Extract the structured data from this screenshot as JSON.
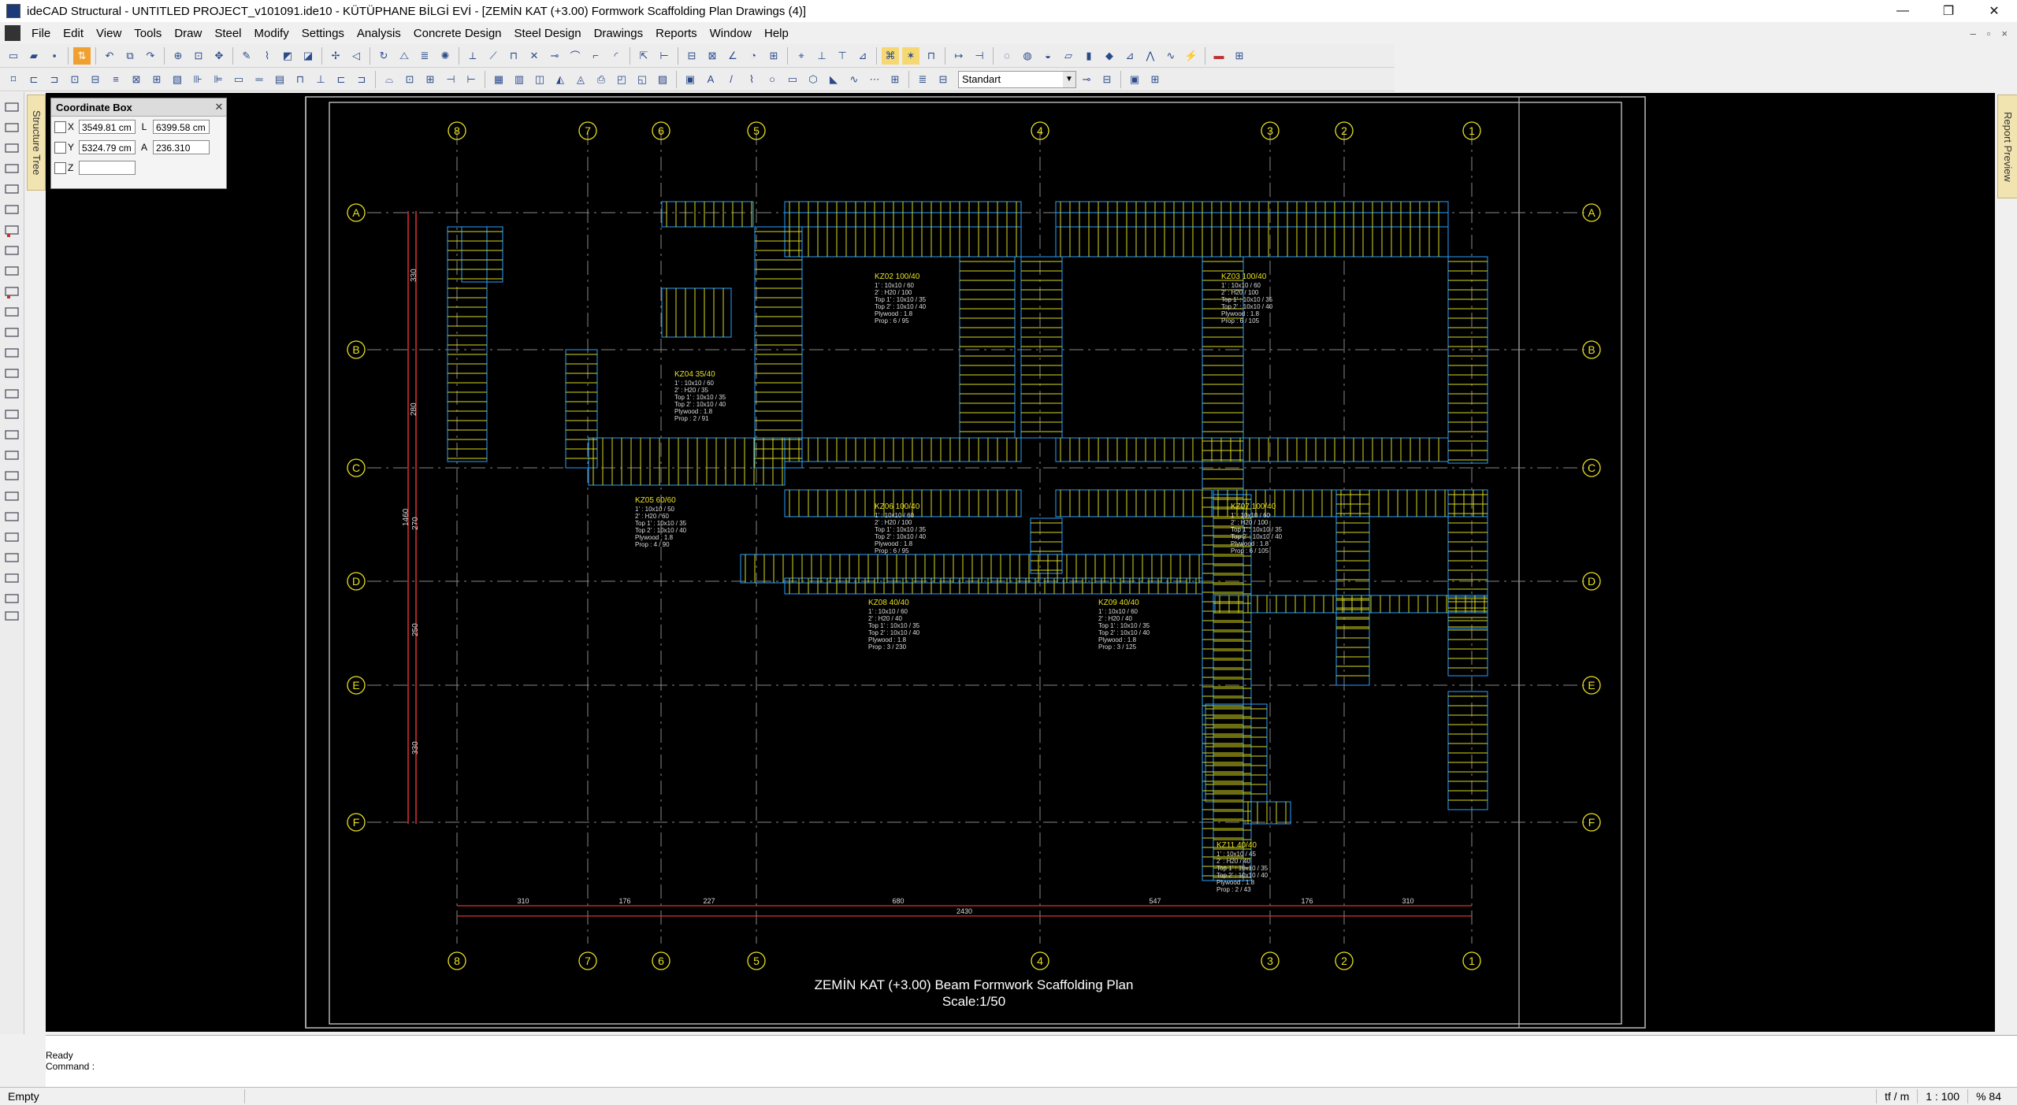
{
  "window": {
    "title": "ideCAD Structural - UNTITLED PROJECT_v101091.ide10 - KÜTÜPHANE BİLGİ EVİ - [ZEMİN KAT (+3.00) Formwork Scaffolding Plan Drawings (4)]",
    "minimize": "—",
    "maximize": "❐",
    "close": "✕"
  },
  "menu": {
    "items": [
      "File",
      "Edit",
      "View",
      "Tools",
      "Draw",
      "Steel",
      "Modify",
      "Settings",
      "Analysis",
      "Concrete Design",
      "Steel Design",
      "Drawings",
      "Reports",
      "Window",
      "Help"
    ],
    "mdi_controls": [
      "–",
      "▫",
      "×"
    ]
  },
  "toolbar": {
    "style_value": "Standart"
  },
  "side_tabs": {
    "left": "Structure Tree",
    "right": "Report Preview"
  },
  "coordinate_box": {
    "title": "Coordinate Box",
    "x_label": "X",
    "x_value": "3549.81 cm",
    "y_label": "Y",
    "y_value": "5324.79 cm",
    "z_label": "Z",
    "z_value": "",
    "l_label": "L",
    "l_value": "6399.58 cm",
    "a_label": "A",
    "a_value": "236.310"
  },
  "drawing": {
    "axes_x": [
      "8",
      "7",
      "6",
      "5",
      "4",
      "3",
      "2",
      "1"
    ],
    "axes_y": [
      "A",
      "B",
      "C",
      "D",
      "E",
      "F"
    ],
    "title": "ZEMİN KAT (+3.00) Beam Formwork Scaffolding Plan",
    "scale": "Scale:1/50",
    "bottom_dims": [
      "310",
      "176",
      "227",
      "680",
      "547",
      "176",
      "310"
    ],
    "total_dim": "2430",
    "left_dims": [
      "330",
      "280",
      "270",
      "250",
      "330"
    ],
    "left_total": "1460",
    "beams": [
      {
        "id": "KZ02 100/40",
        "lines": [
          "1' : 10x10 / 60",
          "2' : H20 / 100",
          "Top 1' : 10x10 / 35",
          "Top 2' : 10x10 / 40",
          "Plywood : 1.8",
          "Prop : 6 / 95"
        ]
      },
      {
        "id": "KZ03 100/40",
        "lines": [
          "1' : 10x10 / 60",
          "2' : H20 / 100",
          "Top 1' : 10x10 / 35",
          "Top 2' : 10x10 / 40",
          "Plywood : 1.8",
          "Prop : 6 / 105"
        ]
      },
      {
        "id": "KZ04 35/40",
        "lines": [
          "1' : 10x10 / 60",
          "2' : H20 / 35",
          "Top 1' : 10x10 / 35",
          "Top 2' : 10x10 / 40",
          "Plywood : 1.8",
          "Prop : 2 / 91"
        ]
      },
      {
        "id": "KZ05 60/60",
        "lines": [
          "1' : 10x10 / 50",
          "2' : H20 / 60",
          "Top 1' : 10x10 / 35",
          "Top 2' : 10x10 / 40",
          "Plywood : 1.8",
          "Prop : 4 / 90"
        ]
      },
      {
        "id": "KZ06 100/40",
        "lines": [
          "1' : 10x10 / 60",
          "2' : H20 / 100",
          "Top 1' : 10x10 / 35",
          "Top 2' : 10x10 / 40",
          "Plywood : 1.8",
          "Prop : 6 / 95"
        ]
      },
      {
        "id": "KZ07 100/40",
        "lines": [
          "1' : 10x10 / 60",
          "2' : H20 / 100",
          "Top 1' : 10x10 / 35",
          "Top 2' : 10x10 / 40",
          "Plywood : 1.8",
          "Prop : 6 / 105"
        ]
      },
      {
        "id": "KZ08 40/40",
        "lines": [
          "1' : 10x10 / 60",
          "2' : H20 / 40",
          "Top 1' : 10x10 / 35",
          "Top 2' : 10x10 / 40",
          "Plywood : 1.8",
          "Prop : 3 / 230"
        ]
      },
      {
        "id": "KZ09 40/40",
        "lines": [
          "1' : 10x10 / 60",
          "2' : H20 / 40",
          "Top 1' : 10x10 / 35",
          "Top 2' : 10x10 / 40",
          "Plywood : 1.8",
          "Prop : 3 / 125"
        ]
      },
      {
        "id": "KZ11 40/40",
        "lines": [
          "1' : 10x10 / 45",
          "2' : H20 / 40",
          "Top 1' : 10x10 / 35",
          "Top 2' : 10x10 / 40",
          "Plywood : 1.8",
          "Prop : 2 / 43"
        ]
      }
    ]
  },
  "command": {
    "line1": "Ready",
    "line2": "Command :"
  },
  "status": {
    "left": "Empty",
    "unit": "tf / m",
    "scale": "1 : 100",
    "zoom": "% 84"
  }
}
